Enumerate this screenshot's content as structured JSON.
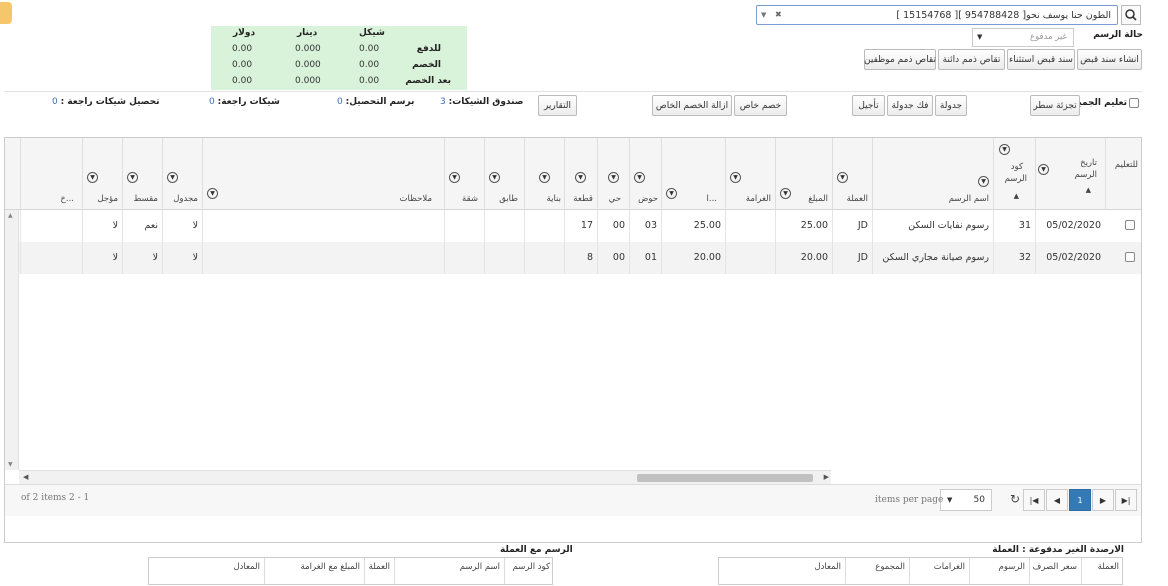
{
  "search": {
    "value": "الطون حنا يوسف نحو[ 954788428 ][ 15154768 ]",
    "clear_glyph": "✖",
    "dropdown_glyph": "▼"
  },
  "status": {
    "label": "حالة الرسم",
    "placeholder": "غير مدفوع"
  },
  "top_buttons": {
    "create_receipt": "انشاء سند قبض",
    "exclusion_receipt": "سند قبض استثناء",
    "clearing_creditor": "تقاص ذمم دائنة",
    "clearing_employees": "تقاص ذمم موظفين"
  },
  "summary": {
    "headers": [
      "شيكل",
      "دينار",
      "دولار"
    ],
    "rows": [
      {
        "label": "للدفع",
        "values": [
          "0.00",
          "0.000",
          "0.00"
        ]
      },
      {
        "label": "الخصم",
        "values": [
          "0.00",
          "0.000",
          "0.00"
        ]
      },
      {
        "label": "بعد الخصم",
        "values": [
          "0.00",
          "0.000",
          "0.00"
        ]
      }
    ]
  },
  "stats": {
    "checks_box_label": "صندوق الشيكات:",
    "checks_box_value": "3",
    "collection_label": "برسم التحصيل:",
    "collection_value": "0",
    "returned_label": "شيكات راجعة:",
    "returned_value": "0",
    "returned_collection_label": "تحصيل شيكات راجعة :",
    "returned_collection_value": "0"
  },
  "actions": {
    "mark_all": "تعليم الجميع",
    "split_row": "تجزئة سطر",
    "schedule": "جدولة",
    "unschedule": "فك جدولة",
    "postpone": "تأجيل",
    "special_discount": "خصم خاص",
    "remove_special_discount": "ازالة الخصم الخاص",
    "reports": "التقارير"
  },
  "grid": {
    "headers": {
      "mark": "للتعليم",
      "date_line1": "تاريخ",
      "date_line2": "الرسم",
      "code_line1": "كود",
      "code_line2": "الرسم",
      "name": "اسم الرسم",
      "currency": "العملة",
      "amount": "المبلغ",
      "fine": "الغرامة",
      "ellipsis": "ا...",
      "basin": "حوض",
      "district": "حي",
      "plot": "قطعة",
      "building": "بناية",
      "floor": "طابق",
      "apartment": "شقة",
      "notes": "ملاحظات",
      "scheduled": "مجدول",
      "installment": "مقسط",
      "deferred": "مؤجل",
      "more": "خ..."
    },
    "rows": [
      {
        "date": "05/02/2020",
        "code": "31",
        "name": "رسوم نفايات السكن",
        "currency": "JD",
        "amount": "25.00",
        "fine": "",
        "value": "25.00",
        "basin": "03",
        "district": "00",
        "plot": "17",
        "building": "",
        "floor": "",
        "apartment": "",
        "notes": "",
        "scheduled": "لا",
        "installment": "نعم",
        "deferred": "لا"
      },
      {
        "date": "05/02/2020",
        "code": "32",
        "name": "رسوم صيانة مجاري السكن",
        "currency": "JD",
        "amount": "20.00",
        "fine": "",
        "value": "20.00",
        "basin": "01",
        "district": "00",
        "plot": "8",
        "building": "",
        "floor": "",
        "apartment": "",
        "notes": "",
        "scheduled": "لا",
        "installment": "لا",
        "deferred": "لا"
      }
    ]
  },
  "pager": {
    "current_page": "1",
    "page_size": "50",
    "items_per_page": "items per page",
    "summary": "1 - 2 of 2 items"
  },
  "bottom": {
    "unpaid_title": "الارصدة الغير مدفوعة : العملة",
    "unpaid_headers": [
      "العملة",
      "سعر الصرف",
      "الرسوم",
      "الغرامات",
      "المجموع",
      "المعادل"
    ],
    "fees_title": "الرسم مع العملة",
    "fees_headers": [
      "كود الرسم",
      "اسم الرسم",
      "العملة",
      "المبلغ مع الغرامة",
      "المعادل"
    ]
  },
  "colors": {
    "summary_bg": "#d9f2da",
    "accent": "#337ab7",
    "stat_value": "#3d6fb5"
  }
}
